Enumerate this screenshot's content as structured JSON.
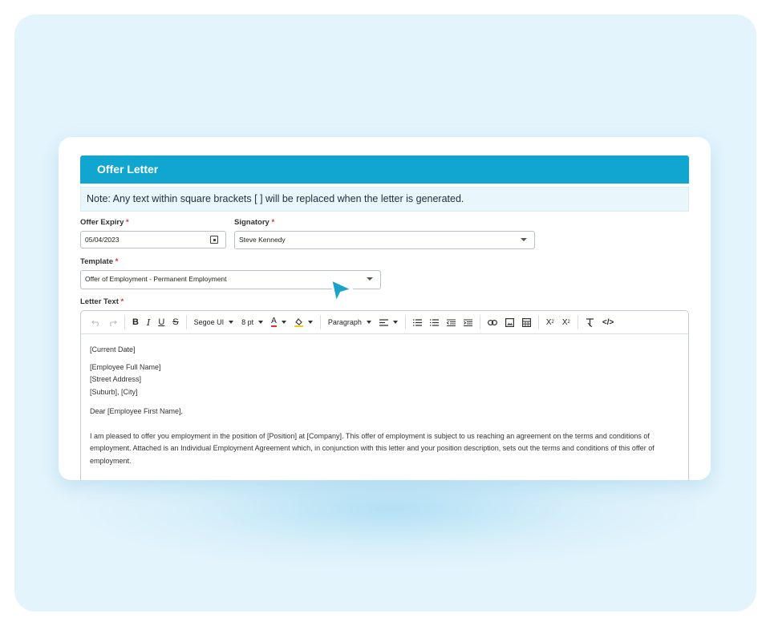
{
  "card": {
    "title": "Offer Letter",
    "note": "Note: Any text within square brackets [ ] will be replaced when the letter is generated."
  },
  "form": {
    "offer_expiry": {
      "label": "Offer Expiry",
      "value": "05/04/2023",
      "required_mark": "*"
    },
    "signatory": {
      "label": "Signatory",
      "value": "Steve Kennedy",
      "required_mark": "*"
    },
    "template": {
      "label": "Template",
      "value": "Offer of Employment - Permanent Employment",
      "required_mark": "*"
    },
    "letter_text": {
      "label": "Letter Text",
      "required_mark": "*"
    }
  },
  "toolbar": {
    "font": "Segoe UI",
    "size": "8 pt",
    "block": "Paragraph",
    "icons": [
      "undo-icon",
      "redo-icon",
      "bold-icon",
      "italic-icon",
      "underline-icon",
      "strikethrough-icon",
      "font-color-icon",
      "highlight-icon",
      "align-icon",
      "bullet-list-icon",
      "numbered-list-icon",
      "outdent-icon",
      "indent-icon",
      "link-icon",
      "image-icon",
      "table-icon",
      "superscript-icon",
      "subscript-icon",
      "clear-format-icon",
      "code-view-icon"
    ]
  },
  "letter": {
    "date": "[Current Date]",
    "name": "[Employee Full Name]",
    "street": "[Street Address]",
    "suburb": "[Suburb], [City]",
    "greeting": "Dear [Employee First Name],",
    "body": "I am pleased to offer you employment in the position of [Position] at [Company]. This offer of employment is subject to us reaching an agreement on the terms and conditions of employment. Attached is an Individual Employment Agreement which, in conjunction with this letter and your position description, sets out the terms and conditions of this offer of employment."
  },
  "colors": {
    "accent": "#11a6cf",
    "required": "#d9342b",
    "background": "#e4f4fc"
  }
}
